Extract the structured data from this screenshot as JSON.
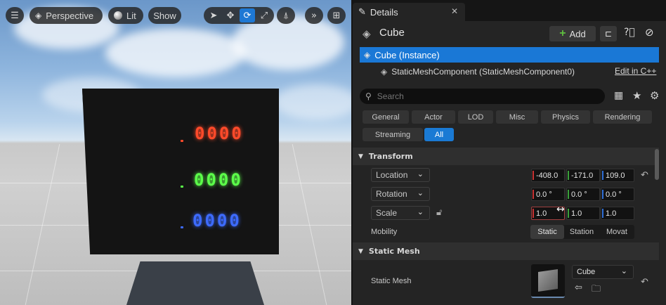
{
  "viewport": {
    "perspective_label": "Perspective",
    "lit_label": "Lit",
    "show_label": "Show",
    "counters": [
      {
        "value": "0000",
        "color": "#ff4a2a"
      },
      {
        "value": "0000",
        "color": "#5cff4a"
      },
      {
        "value": "0000",
        "color": "#3d6bff"
      }
    ]
  },
  "details": {
    "tab_label": "Details",
    "object_name": "Cube",
    "add_label": "Add",
    "hierarchy": {
      "instance": "Cube (Instance)",
      "component": "StaticMeshComponent (StaticMeshComponent0)",
      "edit_link": "Edit in C++"
    },
    "search_placeholder": "Search",
    "categories_row1": [
      "General",
      "Actor",
      "LOD",
      "Misc",
      "Physics",
      "Rendering"
    ],
    "categories_row2": [
      "Streaming",
      "All"
    ],
    "active_category": "All",
    "transform": {
      "header": "Transform",
      "location": {
        "label": "Location",
        "x": "-408.0",
        "y": "-171.0",
        "z": "109.0"
      },
      "rotation": {
        "label": "Rotation",
        "x": "0.0 °",
        "y": "0.0 °",
        "z": "0.0 °"
      },
      "scale": {
        "label": "Scale",
        "x": "1.0",
        "y": "1.0",
        "z": "1.0"
      },
      "mobility": {
        "label": "Mobility",
        "options": [
          "Static",
          "Station",
          "Movat"
        ],
        "selected": "Static"
      }
    },
    "static_mesh": {
      "header": "Static Mesh",
      "label": "Static Mesh",
      "value": "Cube"
    },
    "colors": {
      "accent": "#1a7ad4",
      "x_axis": "#c83232",
      "y_axis": "#3aa03a",
      "z_axis": "#2f6fd6"
    }
  }
}
